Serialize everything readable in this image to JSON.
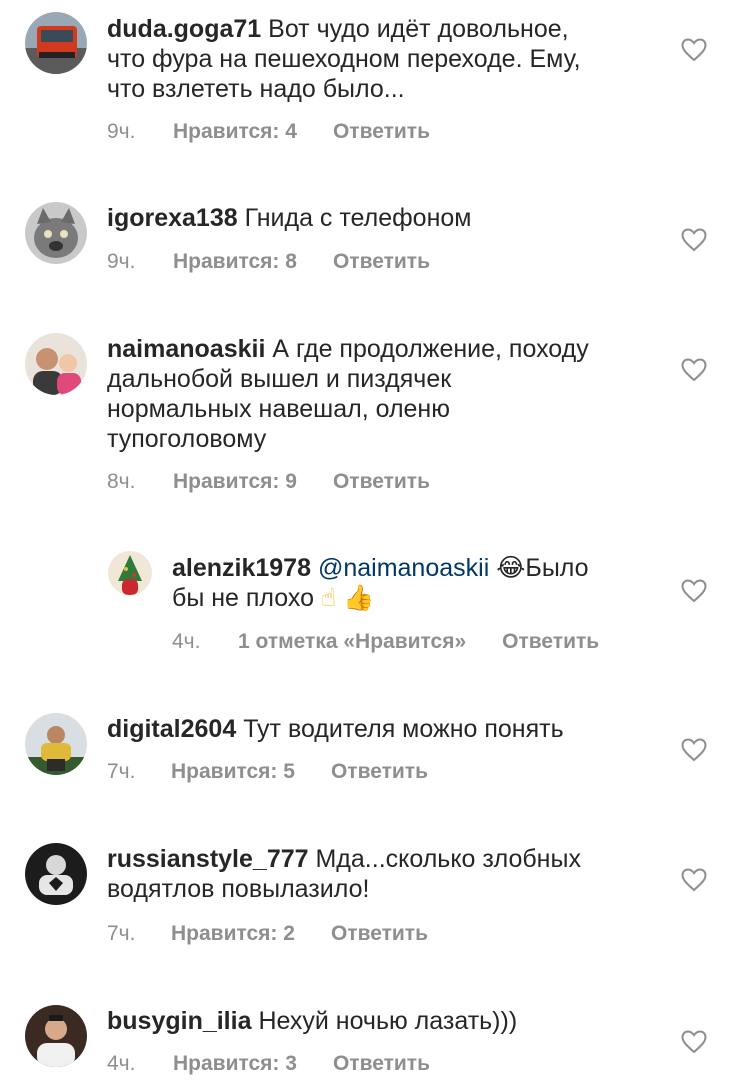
{
  "comments": [
    {
      "username": "duda.goga71",
      "text_lines": [
        "Вот чудо идёт довольное,",
        "что фура на пешеходном переходе. Ему,",
        "что взлететь надо было..."
      ],
      "time": "9ч.",
      "likes": "Нравится: 4",
      "reply": "Ответить",
      "avatar_icon": "truck-avatar"
    },
    {
      "username": "igorexa138",
      "text_lines": [
        "Гнида с телефоном"
      ],
      "time": "9ч.",
      "likes": "Нравится: 8",
      "reply": "Ответить",
      "avatar_icon": "cat-avatar"
    },
    {
      "username": "naimanoaskii",
      "text_lines": [
        "А где продолжение, походу",
        "дальнобой вышел и пиздячек",
        "нормальных навешал, оленю",
        "тупоголовому"
      ],
      "time": "8ч.",
      "likes": "Нравится: 9",
      "reply": "Ответить",
      "avatar_icon": "people-avatar"
    },
    {
      "username": "alenzik1978",
      "mention": "@naimanoaskii",
      "emoji_laugh": "😂",
      "text_after": "Было",
      "text_line2": "бы не плохо",
      "emoji_point": "☝",
      "emoji_thumb": "👍",
      "time": "4ч.",
      "likes": "1 отметка «Нравится»",
      "reply": "Ответить",
      "avatar_icon": "christmas-tree-avatar"
    },
    {
      "username": "digital2604",
      "text_lines": [
        "Тут водителя можно понять"
      ],
      "time": "7ч.",
      "likes": "Нравится: 5",
      "reply": "Ответить",
      "avatar_icon": "man-avatar"
    },
    {
      "username": "russianstyle_777",
      "text_lines": [
        "Мда...сколько злобных",
        "водятлов повылазило!"
      ],
      "time": "7ч.",
      "likes": "Нравится: 2",
      "reply": "Ответить",
      "avatar_icon": "logo-avatar"
    },
    {
      "username": "busygin_ilia",
      "text_lines": [
        "Нехуй ночью лазать)))"
      ],
      "time": "4ч.",
      "likes": "Нравится: 3",
      "reply": "Ответить",
      "avatar_icon": "portrait-avatar"
    }
  ],
  "colors": {
    "text": "#262626",
    "meta": "#8e8e8e",
    "mention": "#00376b",
    "heart": "#8e8e8e"
  }
}
